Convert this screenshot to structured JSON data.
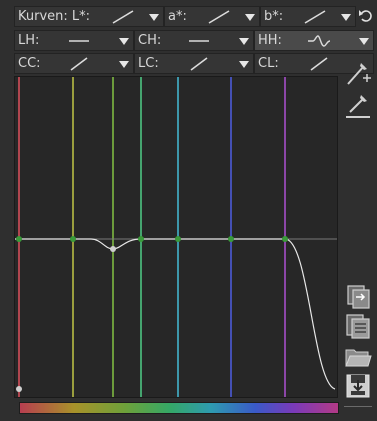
{
  "row1": {
    "curves_label": "Kurven: L*:",
    "a_label": "a*:",
    "b_label": "b*:"
  },
  "row2": {
    "lh_label": "LH:",
    "ch_label": "CH:",
    "hh_label": "HH:"
  },
  "row3": {
    "cc_label": "CC:",
    "lc_label": "LC:",
    "cl_label": "CL:"
  },
  "curve_editor": {
    "hue_lines": [
      "#b0464f",
      "#9a9e3e",
      "#6c9b3c",
      "#45a46f",
      "#3d97ab",
      "#4450b4",
      "#8c46a8"
    ]
  },
  "colors": {
    "panel_bg": "#2f2f2f",
    "plot_bg": "#272727",
    "active_bg": "#4a4a4a"
  }
}
